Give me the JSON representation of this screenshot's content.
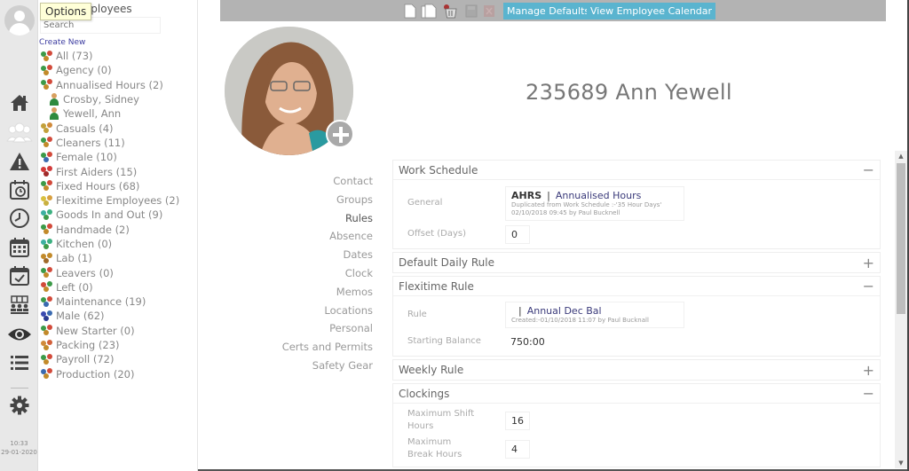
{
  "tooltip": "Options",
  "rail": {
    "icons": [
      "home-icon",
      "employees-icon",
      "alert-icon",
      "schedule-clock-icon",
      "clock-icon",
      "calendar-icon",
      "calendar-check-icon",
      "teams-icon",
      "eye-icon",
      "list-icon",
      "gear-icon"
    ],
    "time": "10:33",
    "date": "29-01-2020"
  },
  "groups": {
    "title": "Employees",
    "search_placeholder": "Search",
    "create_new": "Create New",
    "items": [
      {
        "label": "All (73)",
        "colors": [
          "#3c9a48",
          "#d24a3a",
          "#c28a2a"
        ],
        "child": false
      },
      {
        "label": "Agency (0)",
        "colors": [
          "#3c9a48",
          "#d24a3a",
          "#c28a2a"
        ],
        "child": false
      },
      {
        "label": "Annualised Hours (2)",
        "colors": [
          "#3c9a48",
          "#d24a3a",
          "#c28a2a"
        ],
        "child": false
      },
      {
        "label": "Crosby, Sidney",
        "person": true,
        "child": true
      },
      {
        "label": "Yewell, Ann",
        "person": true,
        "child": true
      },
      {
        "label": "Casuals (4)",
        "colors": [
          "#c2a03a",
          "#d08a3a",
          "#c2a03a"
        ],
        "child": false
      },
      {
        "label": "Cleaners (11)",
        "colors": [
          "#3c9a48",
          "#d24a3a",
          "#c28a2a"
        ],
        "child": false
      },
      {
        "label": "Female (10)",
        "colors": [
          "#3c9a48",
          "#d24a3a",
          "#3a6ab0"
        ],
        "child": false
      },
      {
        "label": "First Aiders (15)",
        "colors": [
          "#d23a3a",
          "#d23a3a",
          "#a02a2a"
        ],
        "child": false
      },
      {
        "label": "Fixed Hours (68)",
        "colors": [
          "#3c9a48",
          "#d24a3a",
          "#c28a2a"
        ],
        "child": false
      },
      {
        "label": "Flexitime Employees (2)",
        "colors": [
          "#d8c040",
          "#d8a040",
          "#c8b040"
        ],
        "child": false
      },
      {
        "label": "Goods In and Out (9)",
        "colors": [
          "#3cb0a0",
          "#3cb080",
          "#3c9a48"
        ],
        "child": false
      },
      {
        "label": "Handmade (2)",
        "colors": [
          "#3c9a48",
          "#d24a3a",
          "#c28a2a"
        ],
        "child": false
      },
      {
        "label": "Kitchen (0)",
        "colors": [
          "#3cb0a0",
          "#3cb080",
          "#3c9a48"
        ],
        "child": false
      },
      {
        "label": "Lab (1)",
        "colors": [
          "#c28a2a",
          "#c28a2a",
          "#a06a2a"
        ],
        "child": false
      },
      {
        "label": "Leavers (0)",
        "colors": [
          "#3c9a48",
          "#d24a3a",
          "#c28a2a"
        ],
        "child": false
      },
      {
        "label": "Left (0)",
        "colors": [
          "#d24a3a",
          "#3c9a48",
          "#c28a2a"
        ],
        "child": false
      },
      {
        "label": "Maintenance (19)",
        "colors": [
          "#3c9a48",
          "#d24a3a",
          "#3a6ab0"
        ],
        "child": false
      },
      {
        "label": "Male (62)",
        "colors": [
          "#3a4ab0",
          "#3a6ab0",
          "#2a3a90"
        ],
        "child": false
      },
      {
        "label": "New Starter (0)",
        "colors": [
          "#3c9a48",
          "#d24a3a",
          "#c28a2a"
        ],
        "child": false
      },
      {
        "label": "Packing (23)",
        "colors": [
          "#d08a3a",
          "#d2603a",
          "#c28a2a"
        ],
        "child": false
      },
      {
        "label": "Payroll (72)",
        "colors": [
          "#3c9a48",
          "#d24a3a",
          "#c28a2a"
        ],
        "child": false
      },
      {
        "label": "Production (20)",
        "colors": [
          "#3a6ab0",
          "#d24a3a",
          "#c28a2a"
        ],
        "child": false
      }
    ]
  },
  "toolbar": {
    "icons": [
      "new-document-icon",
      "copy-document-icon",
      "delete-icon",
      "save-icon",
      "cancel-icon"
    ],
    "manage_defaults": "Manage Defaults",
    "view_calendar": "View Employee Calendar",
    "accent": "#5ab4cf"
  },
  "employee": {
    "title": "235689 Ann Yewell"
  },
  "side_nav": {
    "items": [
      "Contact",
      "Groups",
      "Rules",
      "Absence",
      "Dates",
      "Clock",
      "Memos",
      "Locations",
      "Personal",
      "Certs and Permits",
      "Safety Gear"
    ],
    "active": "Rules"
  },
  "panels": {
    "work_schedule": {
      "title": "Work Schedule",
      "toggle": "−",
      "general_label": "General",
      "code": "AHRS",
      "separator": "|",
      "name": "Annualised Hours",
      "meta1": "Duplicated from Work Schedule :-'35 Hour Days'",
      "meta2": "02/10/2018 09:45 by Paul Bucknell",
      "offset_label": "Offset (Days)",
      "offset_value": "0"
    },
    "default_daily": {
      "title": "Default Daily Rule",
      "toggle": "+"
    },
    "flexitime": {
      "title": "Flexitime Rule",
      "toggle": "−",
      "rule_label": "Rule",
      "separator": "|",
      "name": "Annual Dec Bal",
      "meta": "Created:-01/10/2018 11:07 by Paul Bucknall",
      "balance_label": "Starting Balance",
      "balance_value": "750:00"
    },
    "weekly": {
      "title": "Weekly Rule",
      "toggle": "+"
    },
    "clockings": {
      "title": "Clockings",
      "toggle": "−",
      "max_shift_label": "Maximum Shift Hours",
      "max_shift_value": "16",
      "max_break_label": "Maximum Break Hours",
      "max_break_value": "4"
    }
  }
}
